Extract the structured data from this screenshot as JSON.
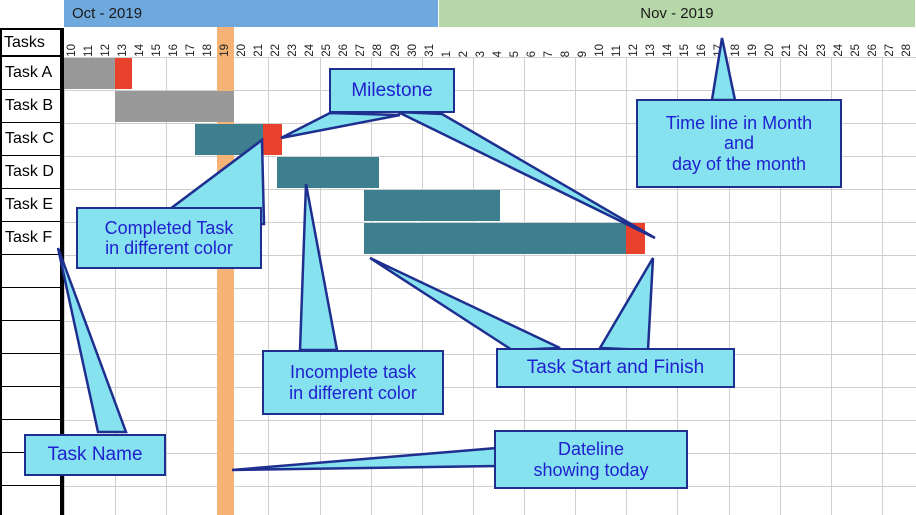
{
  "chart_data": {
    "type": "bar",
    "chart_kind": "gantt",
    "title": "",
    "xlabel": "",
    "ylabel": "Tasks",
    "grid": true,
    "months": [
      {
        "label": "Oct - 2019",
        "color": "#6fa8dc",
        "start_day": 10,
        "end_day": 31
      },
      {
        "label": "Nov - 2019",
        "color": "#b6d7a8",
        "start_day": 1,
        "end_day": 28
      }
    ],
    "day_ticks": [
      "10",
      "11",
      "12",
      "13",
      "14",
      "15",
      "16",
      "17",
      "18",
      "19",
      "20",
      "21",
      "22",
      "23",
      "24",
      "25",
      "26",
      "27",
      "28",
      "29",
      "30",
      "31",
      "1",
      "2",
      "3",
      "4",
      "5",
      "6",
      "7",
      "8",
      "9",
      "10",
      "11",
      "12",
      "13",
      "14",
      "15",
      "16",
      "17",
      "18",
      "19",
      "20",
      "21",
      "22",
      "23",
      "24",
      "25",
      "26",
      "27",
      "28"
    ],
    "today_tick": "19",
    "today_index": 9,
    "categories": [
      "Task A",
      "Task B",
      "Task C",
      "Task D",
      "Task E",
      "Task F"
    ],
    "series": [
      {
        "name": "Task A",
        "row": 0,
        "segments": [
          {
            "kind": "completed",
            "color": "#999999",
            "start_index": 0,
            "end_index": 3
          },
          {
            "kind": "milestone",
            "color": "#e8412c",
            "start_index": 3,
            "end_index": 4
          }
        ]
      },
      {
        "name": "Task B",
        "row": 1,
        "segments": [
          {
            "kind": "completed",
            "color": "#999999",
            "start_index": 3,
            "end_index": 10
          }
        ]
      },
      {
        "name": "Task C",
        "row": 2,
        "segments": [
          {
            "kind": "incomplete",
            "color": "#3d7f8e",
            "start_index": 7.7,
            "end_index": 11.7
          },
          {
            "kind": "milestone",
            "color": "#e8412c",
            "start_index": 11.7,
            "end_index": 12.8
          }
        ]
      },
      {
        "name": "Task D",
        "row": 3,
        "segments": [
          {
            "kind": "incomplete",
            "color": "#3d7f8e",
            "start_index": 12.5,
            "end_index": 18.5
          }
        ]
      },
      {
        "name": "Task E",
        "row": 4,
        "segments": [
          {
            "kind": "incomplete",
            "color": "#3d7f8e",
            "start_index": 17.6,
            "end_index": 25.6
          }
        ]
      },
      {
        "name": "Task F",
        "row": 5,
        "segments": [
          {
            "kind": "incomplete",
            "color": "#3d7f8e",
            "start_index": 17.6,
            "end_index": 33.0
          },
          {
            "kind": "milestone",
            "color": "#e8412c",
            "start_index": 33.0,
            "end_index": 34.1
          }
        ]
      }
    ],
    "legend": [
      {
        "label": "Completed Task",
        "color": "#999999"
      },
      {
        "label": "Incomplete task",
        "color": "#3d7f8e"
      },
      {
        "label": "Milestone / Start and Finish",
        "color": "#e8412c"
      },
      {
        "label": "Dateline showing today",
        "color": "#f5b375"
      }
    ]
  },
  "table": {
    "header_label": "Tasks",
    "rows": [
      {
        "label": "Task A"
      },
      {
        "label": "Task B"
      },
      {
        "label": "Task C"
      },
      {
        "label": "Task D"
      },
      {
        "label": "Task E"
      },
      {
        "label": "Task F"
      },
      {
        "label": ""
      },
      {
        "label": ""
      },
      {
        "label": ""
      },
      {
        "label": ""
      },
      {
        "label": ""
      },
      {
        "label": ""
      },
      {
        "label": ""
      },
      {
        "label": ""
      }
    ]
  },
  "callouts": {
    "milestone": {
      "line1": "Milestone"
    },
    "timeline": {
      "line1": "Time line in Month",
      "line2": "and",
      "line3": "day of the month"
    },
    "completed": {
      "line1": "Completed Task",
      "line2": "in different color"
    },
    "incomplete": {
      "line1": "Incomplete task",
      "line2": "in different color"
    },
    "start_finish": {
      "line1": "Task Start and Finish"
    },
    "dateline": {
      "line1": "Dateline",
      "line2": "showing today"
    },
    "task_name": {
      "line1": "Task Name"
    }
  },
  "colors": {
    "oct_band": "#6fa8dc",
    "nov_band": "#b6d7a8",
    "completed_bar": "#999999",
    "incomplete_bar": "#3d7f8e",
    "milestone_bar": "#e8412c",
    "today_line": "#f5b375",
    "callout_fill": "#86e2ef",
    "callout_border": "#1f2f8f",
    "callout_text": "#2020d0"
  }
}
